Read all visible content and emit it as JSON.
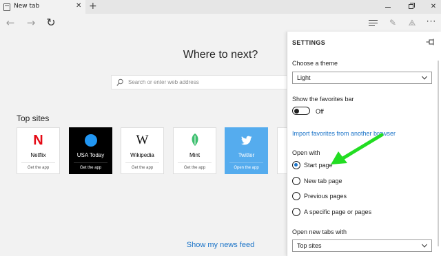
{
  "tab": {
    "title": "New tab",
    "close_glyph": "✕"
  },
  "titlebar": {
    "new_tab_glyph": "+",
    "close_glyph": "✕"
  },
  "toolbar": {
    "back_glyph": "←",
    "forward_glyph": "→",
    "refresh_glyph": "↻",
    "note_glyph": "✎",
    "share_glyph": "⟁",
    "more_glyph": "···"
  },
  "main": {
    "headline": "Where to next?",
    "search_placeholder": "Search or enter web address",
    "top_sites_title": "Top sites",
    "news_feed_link": "Show my news feed"
  },
  "tiles": [
    {
      "name": "Netflix",
      "action": "Get the app",
      "logo": "N",
      "icon": "netflix-logo-icon"
    },
    {
      "name": "USA Today",
      "action": "Get the app",
      "logo": "",
      "icon": "usa-today-logo-icon"
    },
    {
      "name": "Wikipedia",
      "action": "Get the app",
      "logo": "W",
      "icon": "wikipedia-logo-icon"
    },
    {
      "name": "Mint",
      "action": "Get the app",
      "logo": "",
      "icon": "mint-leaf-icon"
    },
    {
      "name": "Twitter",
      "action": "Open the app",
      "logo": "",
      "icon": "twitter-bird-icon"
    }
  ],
  "settings": {
    "title": "SETTINGS",
    "theme_label": "Choose a theme",
    "theme_value": "Light",
    "favorites_bar_label": "Show the favorites bar",
    "favorites_bar_state": "Off",
    "import_link": "Import favorites from another browser",
    "open_with_label": "Open with",
    "open_with_options": [
      "Start page",
      "New tab page",
      "Previous pages",
      "A specific page or pages"
    ],
    "open_with_selected": "Start page",
    "new_tabs_label": "Open new tabs with",
    "new_tabs_value": "Top sites"
  },
  "colors": {
    "accent": "#1a73c8",
    "netflix_red": "#e50914",
    "usa_today_blue": "#2196f3",
    "twitter_blue": "#55acee",
    "mint_green": "#3dbf6f",
    "annotation_green": "#22dd22"
  }
}
